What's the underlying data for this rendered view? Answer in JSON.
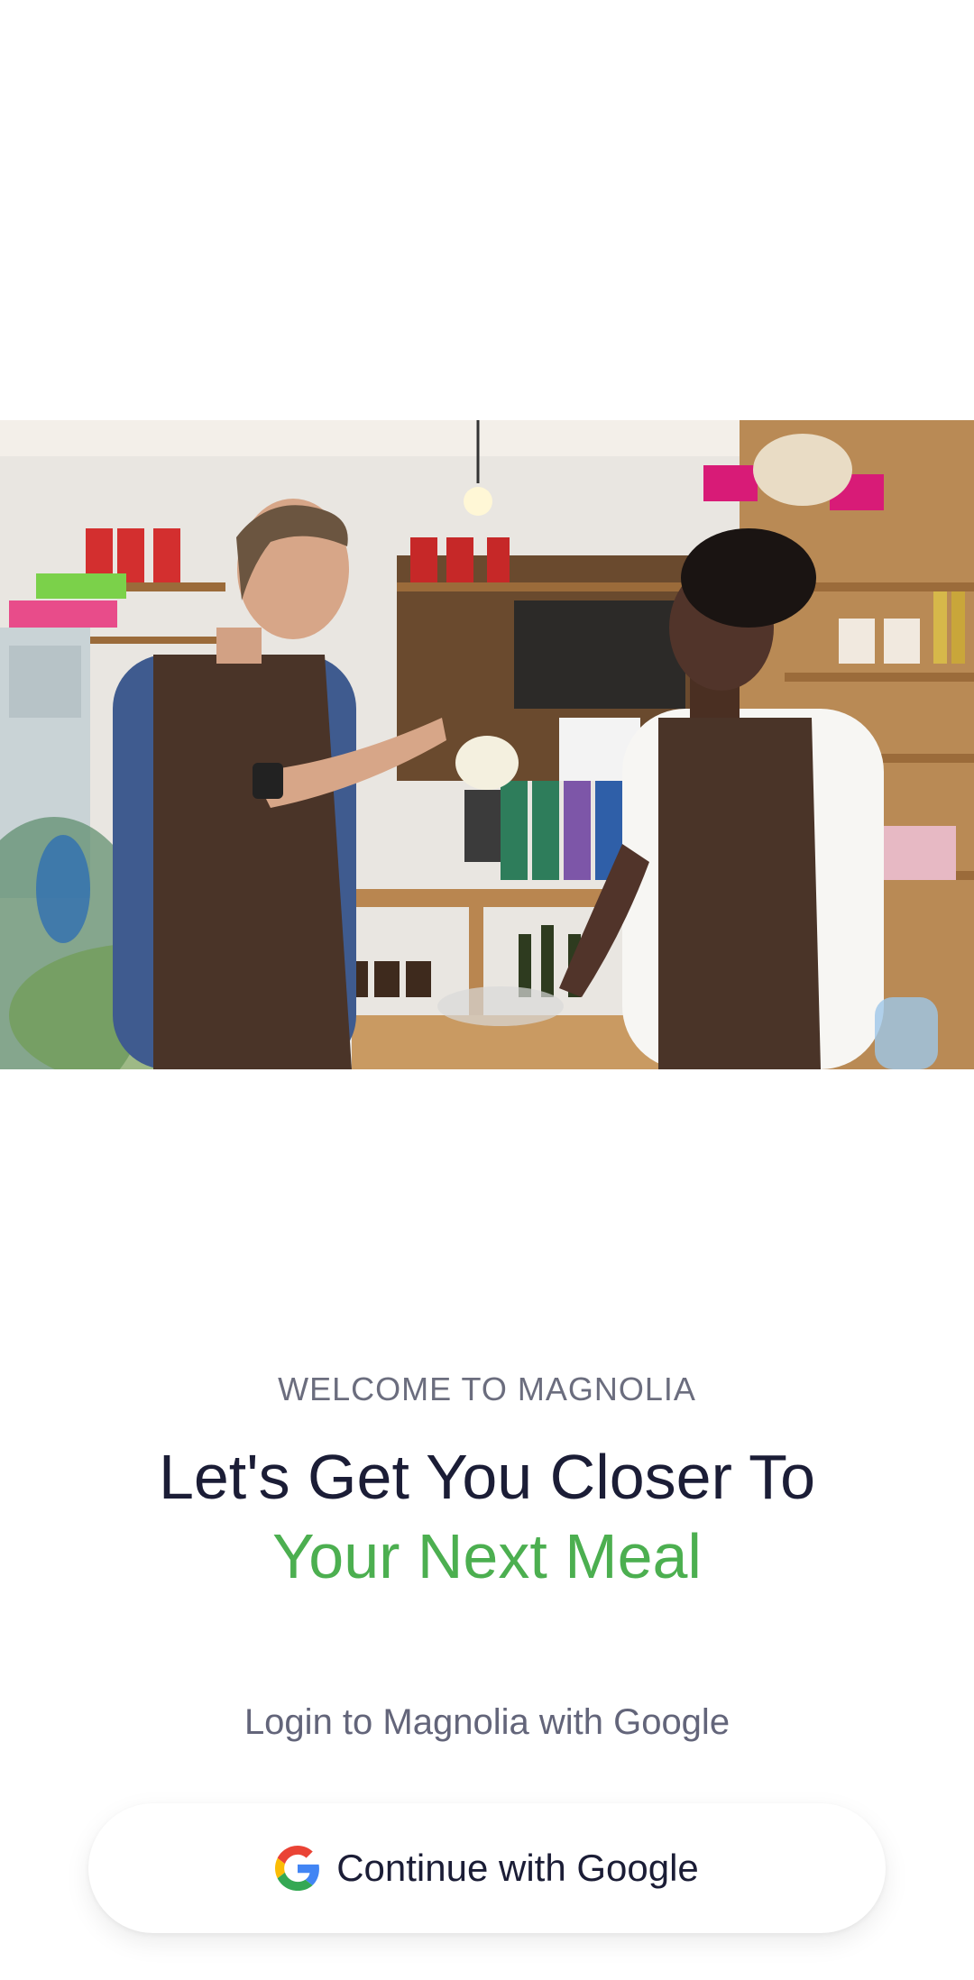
{
  "hero": {
    "image_icon": "grocery-shop-photo"
  },
  "welcome": {
    "eyebrow": "WELCOME TO MAGNOLIA",
    "headline_line1": "Let's Get You Closer To",
    "headline_line2": "Your Next Meal",
    "accent_color": "#4caf50"
  },
  "login": {
    "prompt": "Login to Magnolia with Google",
    "button_label": "Continue with Google",
    "button_icon": "google-icon"
  }
}
